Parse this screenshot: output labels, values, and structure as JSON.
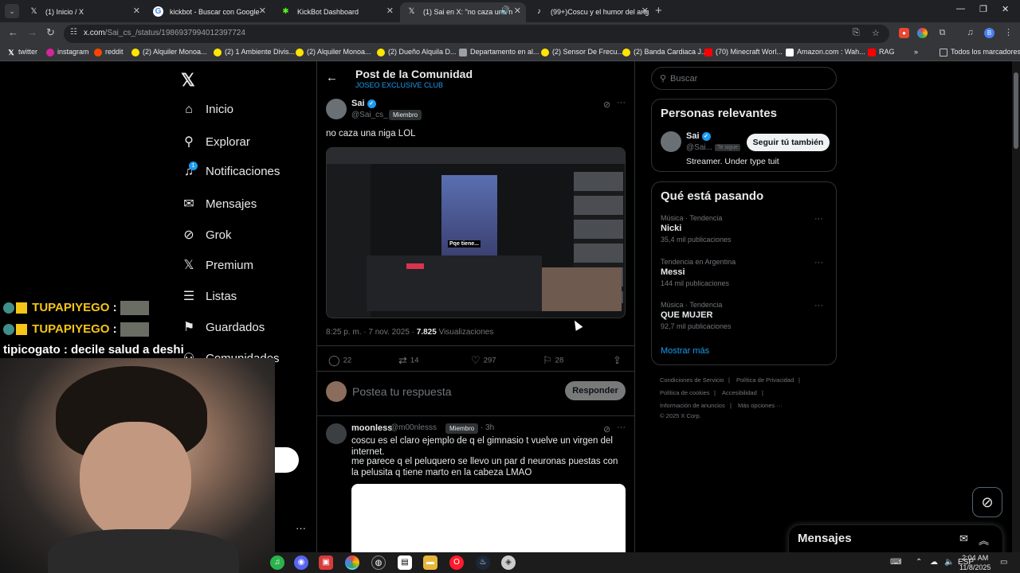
{
  "browser": {
    "tabs": [
      {
        "label": "(1) Inicio / X",
        "icon": "x-logo-icon"
      },
      {
        "label": "kickbot - Buscar con Google",
        "icon": "google-icon"
      },
      {
        "label": "KickBot Dashboard",
        "icon": "kickbot-icon"
      },
      {
        "label": "(1) Sai en X: \"no caza una n",
        "icon": "x-logo-icon"
      },
      {
        "label": "(99+)Coscu y el humor del ang",
        "icon": "tiktok-icon"
      }
    ],
    "url_host": "x.com",
    "url_path": "/Sai_cs_/status/1986937994012397724",
    "bookmarks": [
      "twitter",
      "instagram",
      "reddit",
      "(2) Alquiler Monoa...",
      "(2) 1 Ambiente Divis...",
      "(2) Alquiler Monoa...",
      "(2) Dueño Alquila D...",
      "Departamento en al...",
      "(2) Sensor De Frecu...",
      "(2) Banda Cardiaca J...",
      "(70) Minecraft Worl...",
      "Amazon.com : Wah...",
      "RAG"
    ],
    "all_bookmarks": "Todos los marcadores",
    "profile_initial": "B"
  },
  "nav": {
    "items": [
      "Inicio",
      "Explorar",
      "Notificaciones",
      "Mensajes",
      "Grok",
      "Premium",
      "Listas",
      "Guardados",
      "Comunidades"
    ],
    "notif_count": "1"
  },
  "stream_chat": [
    {
      "name": "TUPAPIYEGO",
      "message": ":"
    },
    {
      "name": "TUPAPIYEGO",
      "message": ":"
    },
    {
      "name": "tipicogato",
      "message": ": decile salud a deshi"
    }
  ],
  "page": {
    "title": "Post de la Comunidad",
    "subtitle": "JOSEO EXCLUSIVE CLUB"
  },
  "post": {
    "author": "Sai",
    "handle": "@Sai_cs_",
    "member": "Miembro",
    "text": "no caza una niga LOL",
    "media_caption": "Pqe tiene...",
    "time": "8:25 p. m. · 7 nov. 2025 ·",
    "views": "7.825",
    "views_label": "Visualizaciones",
    "replies": "22",
    "reposts": "14",
    "likes": "297",
    "bookmarks": "28"
  },
  "reply_box": {
    "placeholder": "Postea tu respuesta",
    "button": "Responder"
  },
  "reply": {
    "author": "moonless",
    "handle": "@m00nlesss",
    "member": "Miembro",
    "time": "· 3h",
    "line1": "coscu es el claro ejemplo de q el gimnasio t vuelve un virgen del internet.",
    "line2": "me parece q el peluquero se llevo un par d neuronas puestas con la pelusita q tiene marto en la cabeza LMAO"
  },
  "sidebar": {
    "search_placeholder": "Buscar",
    "relevant_title": "Personas relevantes",
    "person": {
      "name": "Sai",
      "handle": "@Sai...",
      "follows_you": "Te sigue",
      "follow_button": "Seguir tú también",
      "bio": "Streamer. Under type tuit"
    },
    "trends_title": "Qué está pasando",
    "trends": [
      {
        "category": "Música · Tendencia",
        "name": "Nicki",
        "count": "35,4 mil publicaciones"
      },
      {
        "category": "Tendencia en Argentina",
        "name": "Messi",
        "count": "144 mil publicaciones"
      },
      {
        "category": "Música · Tendencia",
        "name": "QUE MUJER",
        "count": "92,7 mil publicaciones"
      }
    ],
    "show_more": "Mostrar más",
    "footer": [
      "Condiciones de Servicio",
      "|",
      "Política de Privacidad",
      "|",
      "Política de cookies",
      "|",
      "Accesibilidad",
      "|",
      "Información de anuncios",
      "|",
      "Más opciones ···",
      "© 2025 X Corp."
    ]
  },
  "messages_drawer": {
    "title": "Mensajes"
  },
  "taskbar": {
    "lang": "ESP",
    "time": "2:04 AM",
    "date": "11/8/2025"
  }
}
